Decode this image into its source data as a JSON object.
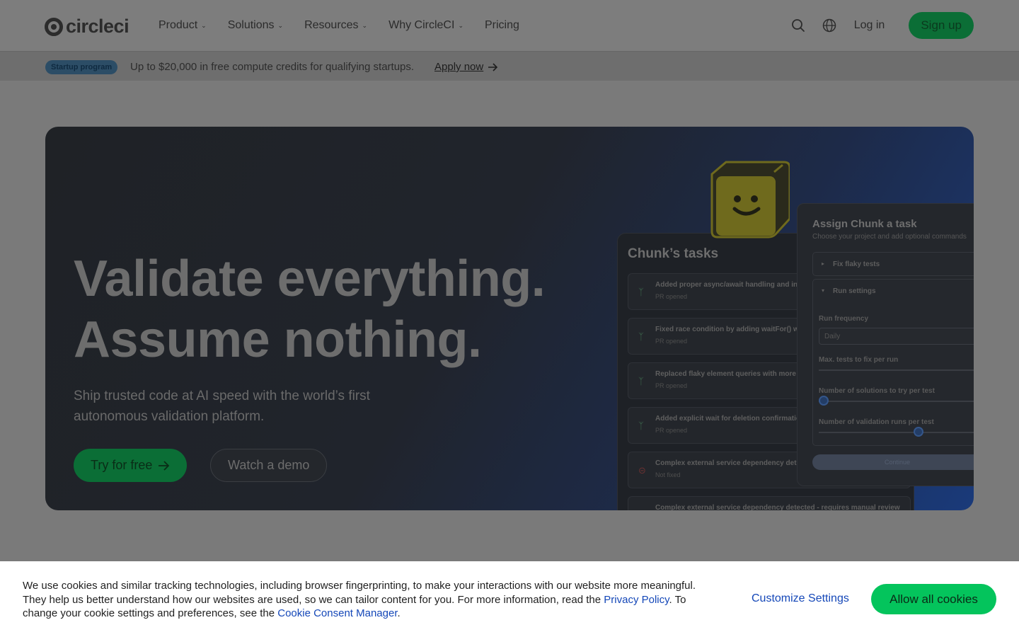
{
  "header": {
    "logo_text": "circleci",
    "nav": [
      {
        "label": "Product",
        "has_dropdown": true
      },
      {
        "label": "Solutions",
        "has_dropdown": true
      },
      {
        "label": "Resources",
        "has_dropdown": true
      },
      {
        "label": "Why CircleCI",
        "has_dropdown": true
      },
      {
        "label": "Pricing",
        "has_dropdown": false
      }
    ],
    "search_icon": "search-icon",
    "language_icon": "globe-icon",
    "login_label": "Log in",
    "signup_label": "Sign up"
  },
  "promo": {
    "badge": "Startup program",
    "text": "Up to $20,000 in free compute credits for qualifying startups.",
    "link_label": "Apply now",
    "link_icon": "arrow-right-icon"
  },
  "hero": {
    "title_line1": "Validate everything.",
    "title_line2": "Assume nothing.",
    "subtitle": "Ship trusted code at AI speed with the world’s first autonomous validation platform.",
    "primary_cta": "Try for free",
    "secondary_cta": "Watch a demo"
  },
  "tasks_panel": {
    "title": "Chunk’s tasks",
    "tasks": [
      {
        "title": "Added proper async/await handling and incr",
        "status": "PR opened",
        "icon": "pull-request-icon"
      },
      {
        "title": "Fixed race condition by adding waitFor() wr",
        "status": "PR opened",
        "icon": "pull-request-icon"
      },
      {
        "title": "Replaced flaky element queries with more r",
        "status": "PR opened",
        "icon": "pull-request-icon"
      },
      {
        "title": "Added explicit wait for deletion confirmatio",
        "status": "PR opened",
        "icon": "pull-request-icon"
      },
      {
        "title": "Complex external service dependency dete",
        "status": "Not fixed",
        "icon": "minus-circle-icon"
      },
      {
        "title": "Complex external service dependency detected - requires manual review",
        "status": "",
        "icon": "minus-circle-icon"
      }
    ]
  },
  "assign_panel": {
    "title": "Assign Chunk a task",
    "subtitle": "Choose your project and add optional commands",
    "accordion_1": "Fix flaky tests",
    "accordion_2": "Run settings",
    "run_frequency_label": "Run frequency",
    "run_frequency_value": "Daily",
    "max_tests_label": "Max. tests to fix per run",
    "solutions_label": "Number of solutions to try per test",
    "solutions_level": 0.0,
    "validation_label": "Number of validation runs per test",
    "validation_level": 0.62,
    "continue_label": "Continue"
  },
  "cookie": {
    "text_1": "We use cookies and similar tracking technologies, including browser fingerprinting, to make your interactions with our website more meaningful. They help us better understand how our websites are used, so we can tailor content for you. For more information, read the ",
    "privacy_link": "Privacy Policy",
    "text_2": ". To change your cookie settings and preferences, see the ",
    "manager_link": "Cookie Consent Manager",
    "text_3": ".",
    "customize_label": "Customize Settings",
    "allow_label": "Allow all cookies"
  },
  "colors": {
    "brand_green": "#04c45c",
    "link_blue": "#1447b8",
    "overlay": "#7a7a7a"
  }
}
